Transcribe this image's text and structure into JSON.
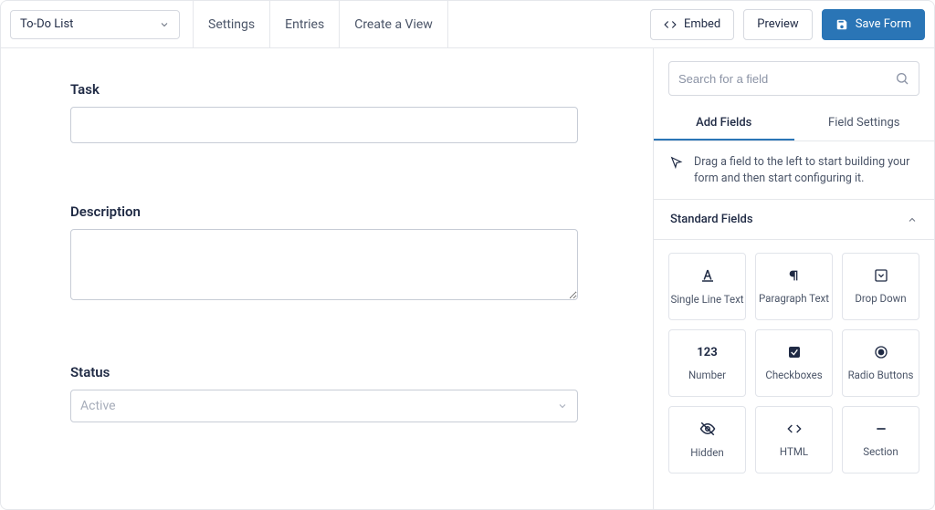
{
  "header": {
    "form_name": "To-Do List",
    "nav": {
      "settings": "Settings",
      "entries": "Entries",
      "create_view": "Create a View"
    },
    "actions": {
      "embed": "Embed",
      "preview": "Preview",
      "save": "Save Form"
    }
  },
  "form_fields": {
    "task": {
      "label": "Task",
      "value": ""
    },
    "description": {
      "label": "Description",
      "value": ""
    },
    "status": {
      "label": "Status",
      "selected": "Active"
    }
  },
  "sidebar": {
    "search_placeholder": "Search for a field",
    "tabs": {
      "add": "Add Fields",
      "settings": "Field Settings"
    },
    "hint": "Drag a field to the left to start building your form and then start configuring it.",
    "group_title": "Standard Fields",
    "fields": [
      {
        "label": "Single Line Text",
        "icon": "text-icon"
      },
      {
        "label": "Paragraph Text",
        "icon": "paragraph-icon"
      },
      {
        "label": "Drop Down",
        "icon": "dropdown-icon"
      },
      {
        "label": "Number",
        "icon": "number-icon"
      },
      {
        "label": "Checkboxes",
        "icon": "checkbox-icon"
      },
      {
        "label": "Radio Buttons",
        "icon": "radio-icon"
      },
      {
        "label": "Hidden",
        "icon": "hidden-icon"
      },
      {
        "label": "HTML",
        "icon": "html-icon"
      },
      {
        "label": "Section",
        "icon": "section-icon"
      }
    ]
  }
}
